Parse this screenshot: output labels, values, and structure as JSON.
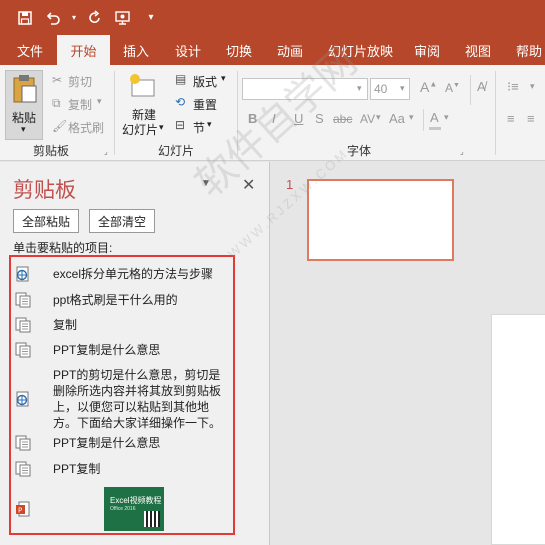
{
  "tabs": [
    "文件",
    "开始",
    "插入",
    "设计",
    "切换",
    "动画",
    "幻灯片放映",
    "审阅",
    "视图",
    "帮助"
  ],
  "ribbon": {
    "clipboard": {
      "paste": "粘贴",
      "cut": "剪切",
      "copy": "复制",
      "format_painter": "格式刷",
      "group_label": "剪贴板"
    },
    "slides": {
      "new_slide_line1": "新建",
      "new_slide_line2": "幻灯片",
      "layout": "版式",
      "reset": "重置",
      "section": "节",
      "group_label": "幻灯片"
    },
    "font": {
      "font_name": "",
      "font_size": "40",
      "group_label": "字体",
      "bold": "B",
      "italic": "I",
      "underline": "U",
      "shadow": "S",
      "strike": "abc",
      "spacing": "AV",
      "case": "Aa"
    }
  },
  "pane": {
    "title": "剪贴板",
    "paste_all": "全部粘贴",
    "clear_all": "全部清空",
    "hint": "单击要粘贴的项目:",
    "items": [
      {
        "icon": "web-clip-icon",
        "text": "excel拆分单元格的方法与步骤"
      },
      {
        "icon": "doc-clip-icon",
        "text": "ppt格式刷是干什么用的"
      },
      {
        "icon": "doc-clip-icon",
        "text": "复制"
      },
      {
        "icon": "doc-clip-icon",
        "text": "PPT复制是什么意思"
      },
      {
        "icon": "web-clip-icon",
        "text": "PPT的剪切是什么意思，剪切是删除所选内容并将其放到剪贴板上，以便您可以粘贴到其他地方。下面给大家详细操作一下。"
      },
      {
        "icon": "doc-clip-icon",
        "text": "PPT复制是什么意思"
      },
      {
        "icon": "doc-clip-icon",
        "text": "PPT复制"
      },
      {
        "icon": "ppt-clip-icon",
        "text": ""
      }
    ],
    "image_clip": {
      "title": "Excel视频教程",
      "subtitle": "Office 2016"
    }
  },
  "thumbnails": {
    "slide_number": "1"
  },
  "watermark": {
    "main": "软件自学网",
    "sub": "WWW.RJZXW.COM"
  },
  "colors": {
    "accent": "#b7472a",
    "highlight_border": "#e53935",
    "pane_title": "#c0504d"
  }
}
